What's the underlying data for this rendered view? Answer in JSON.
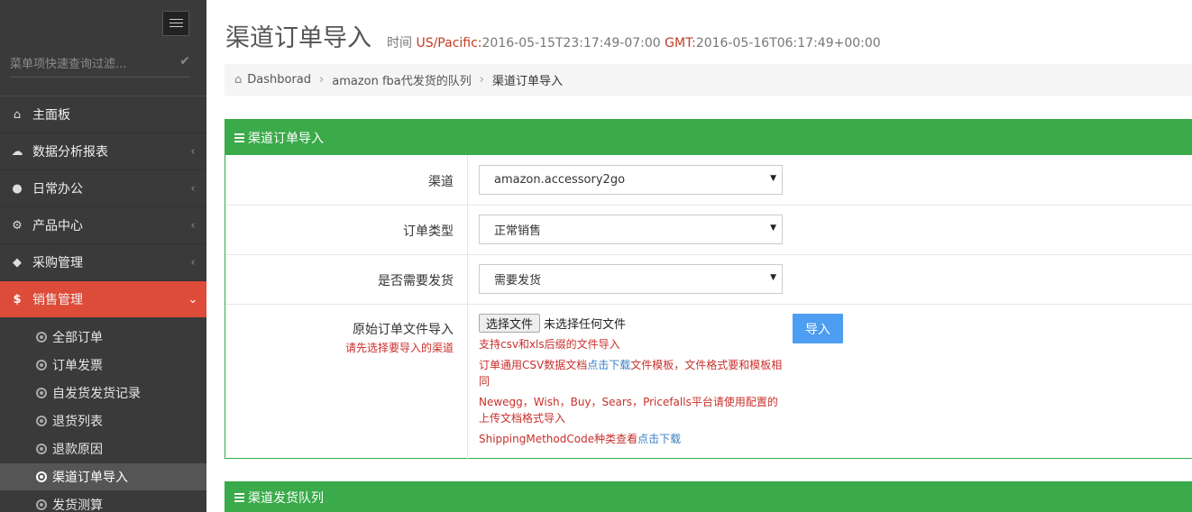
{
  "sidebar": {
    "filter_placeholder": "菜单项快速查询过滤...",
    "items": [
      {
        "label": "主面板",
        "icon": "home-icon"
      },
      {
        "label": "数据分析报表",
        "icon": "cloud-icon"
      },
      {
        "label": "日常办公",
        "icon": "android-icon"
      },
      {
        "label": "产品中心",
        "icon": "cogs-icon"
      },
      {
        "label": "采购管理",
        "icon": "cube-icon"
      },
      {
        "label": "销售管理",
        "icon": "dollar-icon",
        "active": true
      }
    ],
    "sub_items": [
      {
        "label": "全部订单"
      },
      {
        "label": "订单发票"
      },
      {
        "label": "自发货发货记录"
      },
      {
        "label": "退货列表"
      },
      {
        "label": "退款原因"
      },
      {
        "label": "渠道订单导入",
        "active": true
      },
      {
        "label": "发货测算"
      }
    ]
  },
  "header": {
    "title": "渠道订单导入",
    "time_prefix": "时间",
    "tz_label": "US/Pacific:",
    "tz_value": "2016-05-15T23:17:49-07:00",
    "gmt_label": "GMT:",
    "gmt_value": "2016-05-16T06:17:49+00:00"
  },
  "breadcrumb": {
    "home": "Dashborad",
    "mid": "amazon fba代发货的队列",
    "current": "渠道订单导入"
  },
  "import_panel": {
    "title": "渠道订单导入",
    "channel_label": "渠道",
    "channel_value": "amazon.accessory2go",
    "order_type_label": "订单类型",
    "order_type_value": "正常销售",
    "ship_label": "是否需要发货",
    "ship_value": "需要发货",
    "file_label": "原始订单文件导入",
    "file_sublabel": "请先选择要导入的渠道",
    "file_button": "选择文件",
    "file_none": "未选择任何文件",
    "import_button": "导入",
    "hint1": "支持csv和xls后缀的文件导入",
    "hint2_a": "订单通用CSV数据文档",
    "hint2_link": "点击下载",
    "hint2_b": "文件模板，文件格式要和模板相同",
    "hint3": "Newegg，Wish，Buy，Sears，Pricefalls平台请使用配置的上传文档格式导入",
    "hint4_a": "ShippingMethodCode种类查看",
    "hint4_link": "点击下载"
  },
  "queue_panel": {
    "title": "渠道发货队列"
  },
  "colors": {
    "sidebar_bg": "#3a3a3a",
    "active_red": "#dd4b39",
    "panel_green": "#3aaa4a",
    "button_blue": "#4d9df0",
    "hint_red": "#c9302c"
  }
}
